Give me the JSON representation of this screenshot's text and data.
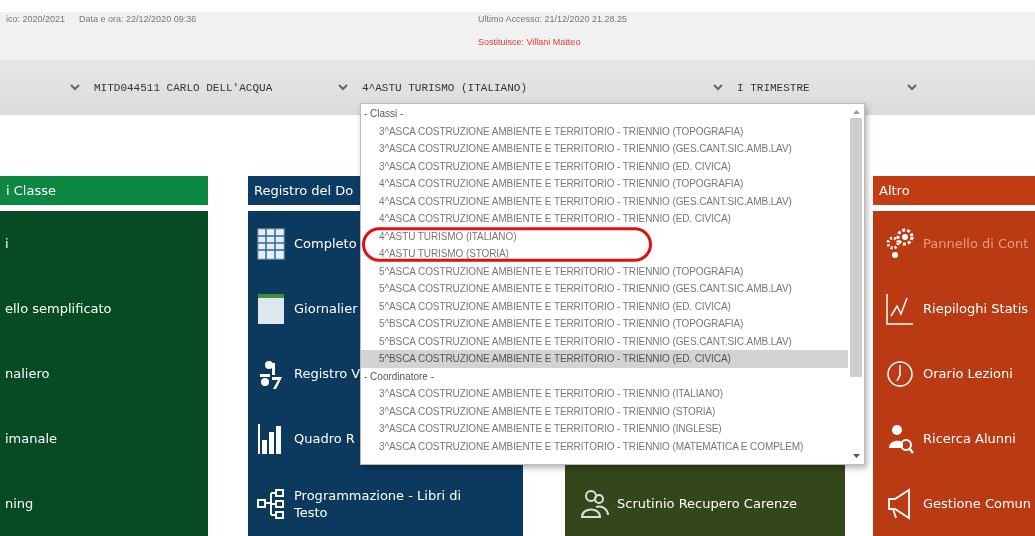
{
  "top_bar": {
    "school_year": "ico: 2020/2021",
    "date_time": "Data e ora: 22/12/2020 09:36",
    "last_access": "Ultimo Accesso: 21/12/2020 21.28.25",
    "substitute": "Sostituisce: Villani Matteo"
  },
  "selectors": [
    {
      "value": "MITD044511 CARLO DELL'ACQUA"
    },
    {
      "value": "4^ASTU TURISMO (ITALIANO)"
    },
    {
      "value": "I TRIMESTRE"
    }
  ],
  "columns": [
    {
      "header": "i Classe",
      "color": "#0d8842",
      "items": [
        {
          "label": "i"
        },
        {
          "label": "ello semplificato"
        },
        {
          "label": "naliero"
        },
        {
          "label": "imanale"
        },
        {
          "label": "ning"
        }
      ]
    },
    {
      "header": "Registro del Do",
      "color": "#0c3c63",
      "items": [
        {
          "label": "Completo"
        },
        {
          "label": "Giornalier"
        },
        {
          "label": "Registro V"
        },
        {
          "label": "Quadro R"
        },
        {
          "label": "Programmazione - Libri di Testo"
        }
      ]
    },
    {
      "color": "#33471a",
      "items": [
        {
          "label": "Scrutinio Recupero Carenze"
        }
      ]
    },
    {
      "header": "Altro",
      "color": "#c23c14",
      "items": [
        {
          "label": "Pannello di Cont",
          "disabled": true
        },
        {
          "label": "Riepiloghi Statis",
          "disabled": false
        },
        {
          "label": "Orario Lezioni",
          "disabled": false
        },
        {
          "label": "Ricerca Alunni",
          "disabled": false
        },
        {
          "label": "Gestione Comun",
          "disabled": false
        }
      ]
    }
  ],
  "dropdown": {
    "groups": [
      {
        "label": "- Classi -",
        "options": [
          {
            "label": "3^ASCA COSTRUZIONE AMBIENTE E TERRITORIO - TRIENNIO (TOPOGRAFIA)",
            "selected": false
          },
          {
            "label": "3^ASCA COSTRUZIONE AMBIENTE E TERRITORIO - TRIENNIO (GES.CANT.SIC.AMB.LAV)",
            "selected": false
          },
          {
            "label": "3^ASCA COSTRUZIONE AMBIENTE E TERRITORIO - TRIENNIO (ED. CIVICA)",
            "selected": false
          },
          {
            "label": "4^ASCA COSTRUZIONE AMBIENTE E TERRITORIO - TRIENNIO (TOPOGRAFIA)",
            "selected": false
          },
          {
            "label": "4^ASCA COSTRUZIONE AMBIENTE E TERRITORIO - TRIENNIO (GES.CANT.SIC.AMB.LAV)",
            "selected": false
          },
          {
            "label": "4^ASCA COSTRUZIONE AMBIENTE E TERRITORIO - TRIENNIO (ED. CIVICA)",
            "selected": false
          },
          {
            "label": "4^ASTU TURISMO (ITALIANO)",
            "selected": false
          },
          {
            "label": "4^ASTU TURISMO (STORIA)",
            "selected": false
          },
          {
            "label": "5^ASCA COSTRUZIONE AMBIENTE E TERRITORIO - TRIENNIO (TOPOGRAFIA)",
            "selected": false
          },
          {
            "label": "5^ASCA COSTRUZIONE AMBIENTE E TERRITORIO - TRIENNIO (GES.CANT.SIC.AMB.LAV)",
            "selected": false
          },
          {
            "label": "5^ASCA COSTRUZIONE AMBIENTE E TERRITORIO - TRIENNIO (ED. CIVICA)",
            "selected": false
          },
          {
            "label": "5^BSCA COSTRUZIONE AMBIENTE E TERRITORIO - TRIENNIO (TOPOGRAFIA)",
            "selected": false
          },
          {
            "label": "5^BSCA COSTRUZIONE AMBIENTE E TERRITORIO - TRIENNIO (GES.CANT.SIC.AMB.LAV)",
            "selected": false
          },
          {
            "label": "5^BSCA COSTRUZIONE AMBIENTE E TERRITORIO - TRIENNIO (ED. CIVICA)",
            "selected": true
          }
        ]
      },
      {
        "label": "- Coordinatore -",
        "options": [
          {
            "label": "3^ASCA COSTRUZIONE AMBIENTE E TERRITORIO - TRIENNIO (ITALIANO)",
            "selected": false
          },
          {
            "label": "3^ASCA COSTRUZIONE AMBIENTE E TERRITORIO - TRIENNIO (STORIA)",
            "selected": false
          },
          {
            "label": "3^ASCA COSTRUZIONE AMBIENTE E TERRITORIO - TRIENNIO (INGLESE)",
            "selected": false
          },
          {
            "label": "3^ASCA COSTRUZIONE AMBIENTE E TERRITORIO - TRIENNIO (MATEMATICA E COMPLEM)",
            "selected": false
          }
        ]
      }
    ]
  }
}
